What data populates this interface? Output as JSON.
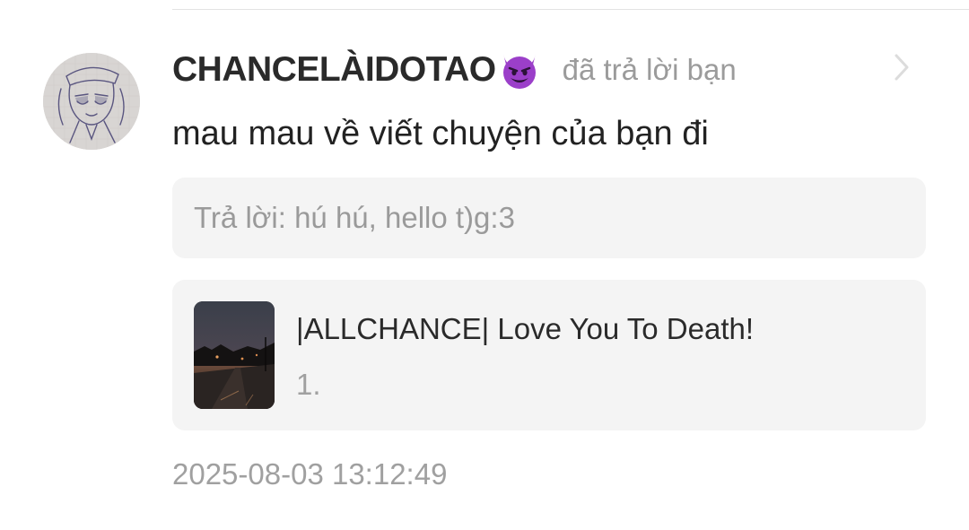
{
  "comment": {
    "username": "CHANCELÀIDOTAO",
    "username_emoji": "devil-emoji",
    "action": "đã trả lời bạn",
    "message": "mau mau về viết chuyện của bạn đi",
    "quoted_reply": "Trả lời: hú hú, hello t)g:3",
    "timestamp": "2025-08-03 13:12:49"
  },
  "story": {
    "title": "|ALLCHANCE| Love You To Death!",
    "chapter": "1."
  },
  "icons": {
    "avatar": "sketch-avatar",
    "chevron": "chevron-right-icon",
    "cover": "night-road-cover"
  },
  "colors": {
    "emoji_purple": "#9b3fc9",
    "card_background": "#f4f4f4",
    "muted_text": "#9b9b9b"
  }
}
